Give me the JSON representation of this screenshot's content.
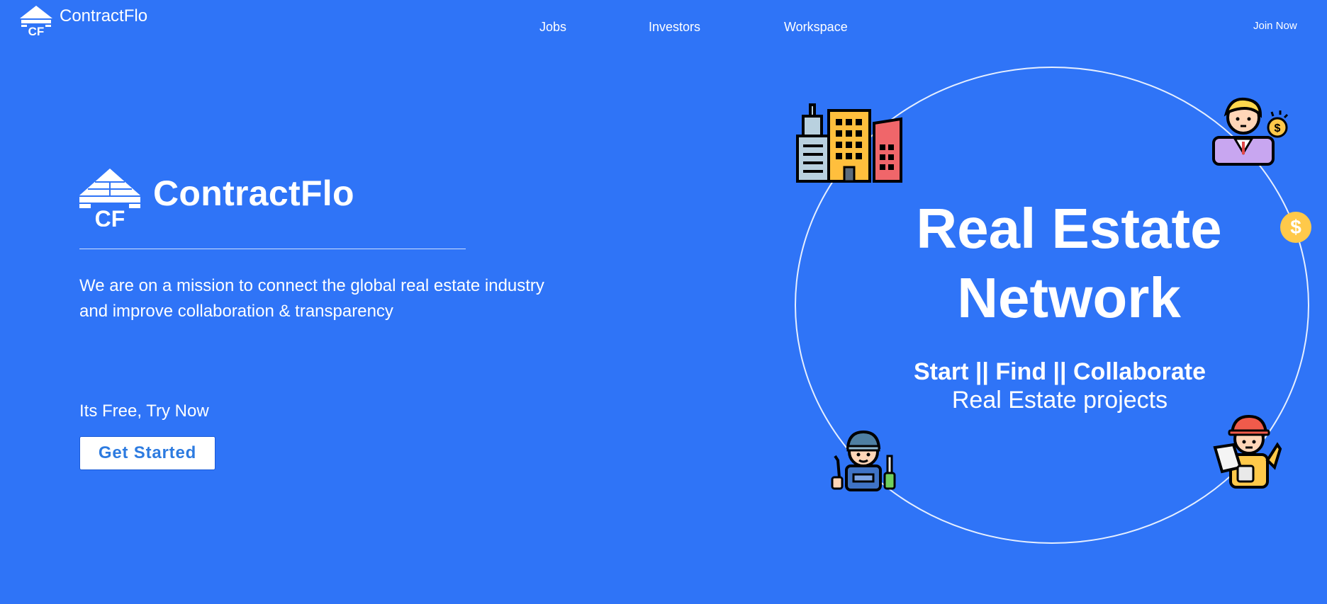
{
  "header": {
    "brand_mark": "CF",
    "brand_name": "ContractFlo",
    "nav": [
      "Jobs",
      "Investors",
      "Workspace"
    ],
    "join_label": "Join Now"
  },
  "hero": {
    "logo_mark": "CF",
    "title": "ContractFlo",
    "mission": "We are on a mission to connect the global real estate industry and improve collaboration & transparency",
    "free_text": "Its Free, Try Now",
    "cta_label": "Get Started"
  },
  "feature": {
    "headline_line1": "Real Estate",
    "headline_line2": "Network",
    "tagline": "Start || Find || Collaborate",
    "tagline2": "Real Estate projects",
    "coin_symbol": "$",
    "icons": [
      "buildings-icon",
      "investor-icon",
      "worker-icon",
      "engineer-icon",
      "dollar-coin-icon"
    ]
  },
  "colors": {
    "background": "#2f74f7",
    "cta_text": "#2d7be0",
    "coin": "#ffc94a"
  }
}
